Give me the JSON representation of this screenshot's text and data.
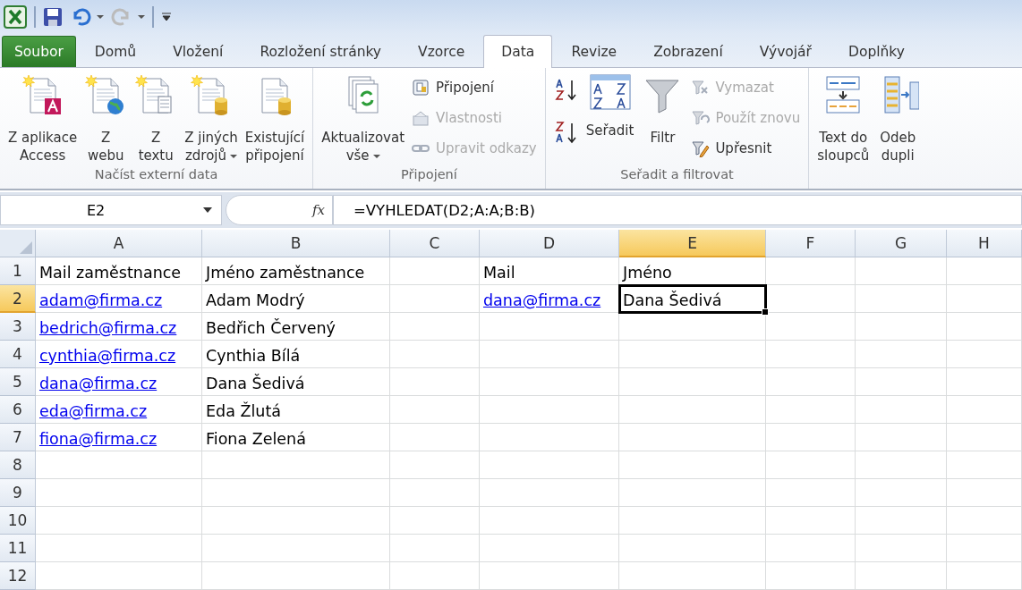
{
  "quick_access": {
    "undo_enabled": true,
    "redo_enabled": false
  },
  "tabs": [
    {
      "label": "Soubor",
      "kind": "file",
      "selected": false
    },
    {
      "label": "Domů",
      "kind": "tab",
      "selected": false
    },
    {
      "label": "Vložení",
      "kind": "tab",
      "selected": false
    },
    {
      "label": "Rozložení stránky",
      "kind": "tab",
      "selected": false
    },
    {
      "label": "Vzorce",
      "kind": "tab",
      "selected": false
    },
    {
      "label": "Data",
      "kind": "tab",
      "selected": true
    },
    {
      "label": "Revize",
      "kind": "tab",
      "selected": false
    },
    {
      "label": "Zobrazení",
      "kind": "tab",
      "selected": false
    },
    {
      "label": "Vývojář",
      "kind": "tab",
      "selected": false
    },
    {
      "label": "Doplňky",
      "kind": "tab",
      "selected": false
    }
  ],
  "ribbon_groups": [
    {
      "label": "Načíst externí data",
      "items": [
        {
          "kind": "large",
          "label": "Z aplikace\nAccess",
          "dropdown": false,
          "disabled": false
        },
        {
          "kind": "large",
          "label": "Z\nwebu",
          "dropdown": false,
          "disabled": false
        },
        {
          "kind": "large",
          "label": "Z\ntextu",
          "dropdown": false,
          "disabled": false
        },
        {
          "kind": "large",
          "label": "Z jiných\nzdrojů",
          "dropdown": true,
          "disabled": false
        },
        {
          "kind": "large",
          "label": "Existující\npřipojení",
          "dropdown": false,
          "disabled": false
        }
      ]
    },
    {
      "label": "Připojení",
      "items": [
        {
          "kind": "large",
          "label": "Aktualizovat\nvše",
          "dropdown": true,
          "disabled": false
        },
        {
          "kind": "small",
          "label": "Připojení",
          "dropdown": false,
          "disabled": false
        },
        {
          "kind": "small",
          "label": "Vlastnosti",
          "dropdown": false,
          "disabled": true
        },
        {
          "kind": "small",
          "label": "Upravit odkazy",
          "dropdown": false,
          "disabled": true
        }
      ]
    },
    {
      "label": "Seřadit a filtrovat",
      "items": [
        {
          "kind": "sortpair",
          "label": "Seřadit",
          "dropdown": false,
          "disabled": false
        },
        {
          "kind": "large",
          "label": "Filtr",
          "dropdown": false,
          "disabled": false
        },
        {
          "kind": "small",
          "label": "Vymazat",
          "dropdown": false,
          "disabled": true
        },
        {
          "kind": "small",
          "label": "Použít znovu",
          "dropdown": false,
          "disabled": true
        },
        {
          "kind": "small",
          "label": "Upřesnit",
          "dropdown": false,
          "disabled": false
        }
      ]
    },
    {
      "items": [
        {
          "kind": "large",
          "label": "Text do\nsloupců",
          "dropdown": false,
          "disabled": false
        },
        {
          "kind": "large",
          "label": "Odeb\ndupli",
          "dropdown": false,
          "disabled": false
        }
      ]
    }
  ],
  "name_box": "E2",
  "fx_label": "fx",
  "formula": "=VYHLEDAT(D2;A:A;B:B)",
  "columns": [
    {
      "label": "A",
      "selected": false
    },
    {
      "label": "B",
      "selected": false
    },
    {
      "label": "C",
      "selected": false
    },
    {
      "label": "D",
      "selected": false
    },
    {
      "label": "E",
      "selected": true
    },
    {
      "label": "F",
      "selected": false
    },
    {
      "label": "G",
      "selected": false
    },
    {
      "label": "H",
      "selected": false
    }
  ],
  "rows": [
    {
      "number": "1",
      "selected": false,
      "cells": [
        {
          "text": "Mail zaměstnance",
          "link": false,
          "selected": false
        },
        {
          "text": "Jméno zaměstnance",
          "link": false,
          "selected": false
        },
        {
          "selected": false
        },
        {
          "text": "Mail",
          "link": false,
          "selected": false
        },
        {
          "text": "Jméno",
          "link": false,
          "selected": false
        }
      ]
    },
    {
      "number": "2",
      "selected": true,
      "cells": [
        {
          "text": "adam@firma.cz",
          "link": true,
          "selected": false
        },
        {
          "text": "Adam Modrý",
          "link": false,
          "selected": false
        },
        {
          "selected": false
        },
        {
          "text": "dana@firma.cz",
          "link": true,
          "selected": false
        },
        {
          "text": "Dana Šedivá",
          "link": false,
          "selected": true
        }
      ]
    },
    {
      "number": "3",
      "selected": false,
      "cells": [
        {
          "text": "bedrich@firma.cz",
          "link": true,
          "selected": false
        },
        {
          "text": "Bedřich Červený",
          "link": false,
          "selected": false
        }
      ]
    },
    {
      "number": "4",
      "selected": false,
      "cells": [
        {
          "text": "cynthia@firma.cz",
          "link": true,
          "selected": false
        },
        {
          "text": "Cynthia Bílá",
          "link": false,
          "selected": false
        }
      ]
    },
    {
      "number": "5",
      "selected": false,
      "cells": [
        {
          "text": "dana@firma.cz",
          "link": true,
          "selected": false
        },
        {
          "text": "Dana Šedivá",
          "link": false,
          "selected": false
        }
      ]
    },
    {
      "number": "6",
      "selected": false,
      "cells": [
        {
          "text": "eda@firma.cz",
          "link": true,
          "selected": false
        },
        {
          "text": "Eda Žlutá",
          "link": false,
          "selected": false
        }
      ]
    },
    {
      "number": "7",
      "selected": false,
      "cells": [
        {
          "text": "fiona@firma.cz",
          "link": true,
          "selected": false
        },
        {
          "text": "Fiona Zelená",
          "link": false,
          "selected": false
        }
      ]
    },
    {
      "number": "8",
      "selected": false
    },
    {
      "number": "9",
      "selected": false
    },
    {
      "number": "10",
      "selected": false
    },
    {
      "number": "11",
      "selected": false
    },
    {
      "number": "12",
      "selected": false
    }
  ]
}
